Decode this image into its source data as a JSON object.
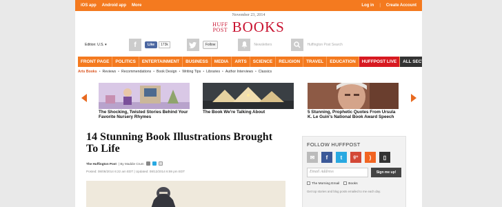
{
  "topbar": {
    "left_links": [
      "iOS app",
      "Android app",
      "More"
    ],
    "login": "Log in",
    "sep": "|",
    "create_account": "Create Account"
  },
  "header": {
    "date": "November 23, 2014",
    "logo_line1": "HUFF",
    "logo_line2": "POST",
    "section_title": "BOOKS"
  },
  "social": {
    "edition": "Edition: U.S. ▾",
    "like_label": "Like",
    "like_count": "173k",
    "follow_label": "Follow",
    "newsletters": "Newsletters",
    "search_placeholder": "Huffington Post Search"
  },
  "nav": [
    "FRONT PAGE",
    "POLITICS",
    "ENTERTAINMENT",
    "BUSINESS",
    "MEDIA",
    "ARTS",
    "SCIENCE",
    "RELIGION",
    "TRAVEL",
    "EDUCATION",
    "HUFFPOST LIVE",
    "ALL SECTIONS"
  ],
  "subnav": [
    "Arts Books",
    "Reviews",
    "Recommendations",
    "Book Design",
    "Writing Tips",
    "Libraries",
    "Author Interviews",
    "Classics"
  ],
  "carousel": [
    {
      "caption": "The Shocking, Twisted Stories Behind Your Favorite Nursery Rhymes"
    },
    {
      "caption": "The Book We're Talking About"
    },
    {
      "caption": "5 Stunning, Prophetic Quotes From Ursula K. Le Guin's National Book Award Speech"
    }
  ],
  "article": {
    "headline": "14 Stunning Book Illustrations Brought To Life",
    "source": "The Huffington Post",
    "author": "| By Maddie Crum",
    "dates": "Posted: 08/08/2014 6:22 am EDT   |   Updated: 08/12/2014 6:59 pm EDT"
  },
  "follow": {
    "title": "FOLLOW HUFFPOST",
    "email_placeholder": "Email Address",
    "signup": "Sign me up!",
    "opt1": "The Morning Email",
    "opt2": "Books",
    "note": "Get top stories and blog posts emailed to me each day."
  },
  "colors": {
    "accent": "#f47a1f",
    "red": "#c8102e",
    "live": "#d71920"
  }
}
